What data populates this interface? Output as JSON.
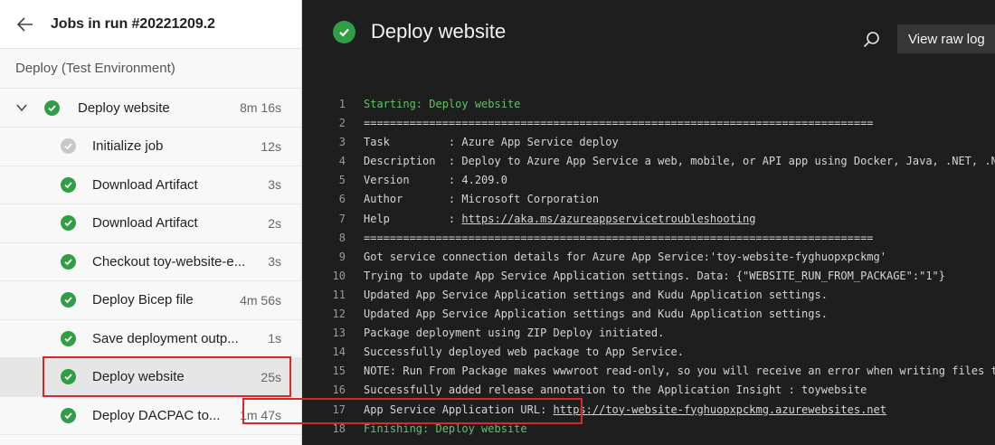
{
  "left_panel": {
    "run_title": "Jobs in run #20221209.2",
    "stage": "Deploy (Test Environment)",
    "parent_job": {
      "label": "Deploy website",
      "duration": "8m 16s",
      "status": "succeeded"
    },
    "steps": [
      {
        "label": "Initialize job",
        "duration": "12s",
        "status": "pending"
      },
      {
        "label": "Download Artifact",
        "duration": "3s",
        "status": "succeeded"
      },
      {
        "label": "Download Artifact",
        "duration": "2s",
        "status": "succeeded"
      },
      {
        "label": "Checkout toy-website-e...",
        "duration": "3s",
        "status": "succeeded"
      },
      {
        "label": "Deploy Bicep file",
        "duration": "4m 56s",
        "status": "succeeded"
      },
      {
        "label": "Save deployment outp...",
        "duration": "1s",
        "status": "succeeded"
      },
      {
        "label": "Deploy website",
        "duration": "25s",
        "status": "succeeded",
        "selected": true
      },
      {
        "label": "Deploy DACPAC to...",
        "duration": "1m 47s",
        "status": "succeeded"
      }
    ]
  },
  "right_panel": {
    "title": "Deploy website",
    "view_raw_log_label": "View raw log",
    "log_lines": [
      {
        "n": "1",
        "text": "Starting: Deploy website",
        "style": "green"
      },
      {
        "n": "2",
        "text": "=============================================================================="
      },
      {
        "n": "3",
        "text": "Task         : Azure App Service deploy"
      },
      {
        "n": "4",
        "text": "Description  : Deploy to Azure App Service a web, mobile, or API app using Docker, Java, .NET, .NET"
      },
      {
        "n": "5",
        "text": "Version      : 4.209.0"
      },
      {
        "n": "6",
        "text": "Author       : Microsoft Corporation"
      },
      {
        "n": "7",
        "prefix": "Help         : ",
        "link": "https://aka.ms/azureappservicetroubleshooting"
      },
      {
        "n": "8",
        "text": "=============================================================================="
      },
      {
        "n": "9",
        "text": "Got service connection details for Azure App Service:'toy-website-fyghuopxpckmg'"
      },
      {
        "n": "10",
        "text": "Trying to update App Service Application settings. Data: {\"WEBSITE_RUN_FROM_PACKAGE\":\"1\"}"
      },
      {
        "n": "11",
        "text": "Updated App Service Application settings and Kudu Application settings."
      },
      {
        "n": "12",
        "text": "Updated App Service Application settings and Kudu Application settings."
      },
      {
        "n": "13",
        "text": "Package deployment using ZIP Deploy initiated."
      },
      {
        "n": "14",
        "text": "Successfully deployed web package to App Service."
      },
      {
        "n": "15",
        "text": "NOTE: Run From Package makes wwwroot read-only, so you will receive an error when writing files to"
      },
      {
        "n": "16",
        "text": "Successfully added release annotation to the Application Insight : toywebsite"
      },
      {
        "n": "17",
        "prefix": "App Service Application URL: ",
        "link": "https://toy-website-fyghuopxpckmg.azurewebsites.net"
      },
      {
        "n": "18",
        "text": "Finishing: Deploy website",
        "style": "green"
      }
    ]
  },
  "colors": {
    "success": "#2f9e44",
    "pending": "#c8c8c8",
    "highlight": "#d62828",
    "log_bg": "#1e1e1e"
  },
  "icons": [
    "back-arrow-icon",
    "chevron-down-icon",
    "check-circle-icon",
    "search-icon"
  ]
}
